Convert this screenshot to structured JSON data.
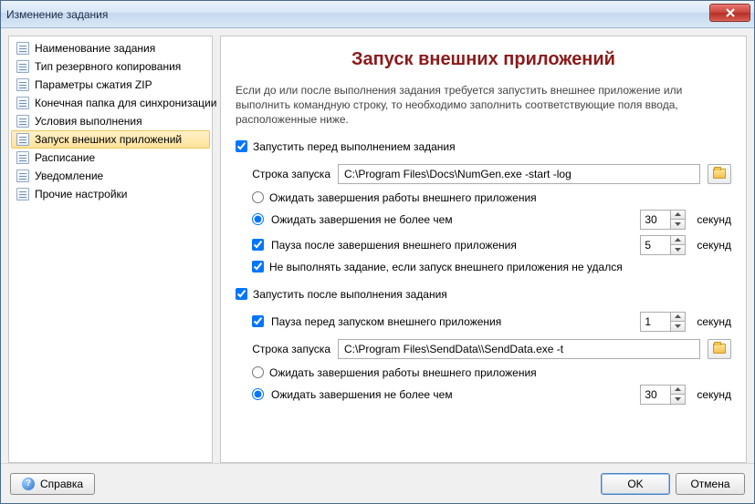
{
  "window": {
    "title": "Изменение задания"
  },
  "sidebar": {
    "items": [
      {
        "label": "Наименование задания"
      },
      {
        "label": "Тип резервного копирования"
      },
      {
        "label": "Параметры сжатия ZIP"
      },
      {
        "label": "Конечная папка для синхронизации"
      },
      {
        "label": "Условия выполнения"
      },
      {
        "label": "Запуск внешних приложений"
      },
      {
        "label": "Расписание"
      },
      {
        "label": "Уведомление"
      },
      {
        "label": "Прочие настройки"
      }
    ],
    "selected_index": 5
  },
  "main": {
    "title": "Запуск внешних приложений",
    "intro": "Если до или после выполнения задания требуется запустить внешнее приложение или выполнить командную строку, то необходимо заполнить соответствующие поля ввода, расположенные ниже.",
    "before": {
      "checkbox_label": "Запустить перед выполнением задания",
      "checked": true,
      "cmd_label": "Строка запуска",
      "cmd_value": "C:\\Program Files\\Docs\\NumGen.exe -start -log",
      "wait_finish_label": "Ожидать завершения работы внешнего приложения",
      "wait_nomore_label": "Ожидать завершения не более чем",
      "wait_selected": "nomore",
      "wait_seconds": "30",
      "seconds_label": "секунд",
      "pause_after_label": "Пауза после завершения внешнего приложения",
      "pause_after_checked": true,
      "pause_after_seconds": "5",
      "abort_label": "Не выполнять задание, если запуск внешнего приложения не удался",
      "abort_checked": true
    },
    "after": {
      "checkbox_label": "Запустить после выполнения задания",
      "checked": true,
      "pause_before_label": "Пауза перед запуском внешнего приложения",
      "pause_before_checked": true,
      "pause_before_seconds": "1",
      "seconds_label": "секунд",
      "cmd_label": "Строка запуска",
      "cmd_value": "C:\\Program Files\\SendData\\\\SendData.exe -t",
      "wait_finish_label": "Ожидать завершения работы внешнего приложения",
      "wait_nomore_label": "Ожидать завершения не более чем",
      "wait_selected": "nomore",
      "wait_seconds": "30"
    }
  },
  "footer": {
    "help": "Справка",
    "ok": "OK",
    "cancel": "Отмена"
  }
}
